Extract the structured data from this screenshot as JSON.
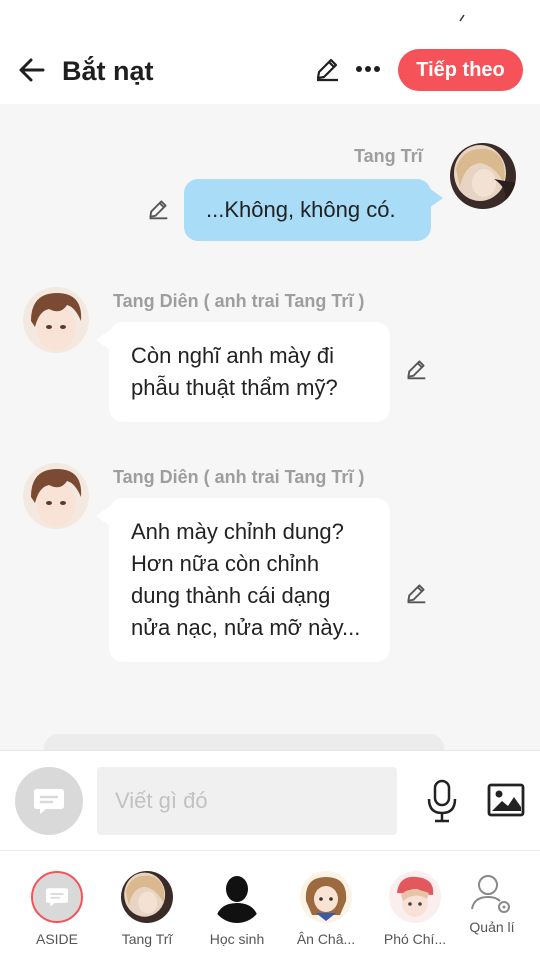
{
  "header": {
    "title": "Bắt nạt",
    "next_label": "Tiếp theo",
    "icons": {
      "back": "arrow-left-icon",
      "edit": "pencil-icon",
      "more": "more-dots-icon"
    },
    "accent_color": "#f5525a"
  },
  "messages": [
    {
      "side": "right",
      "sender": "Tang Trĩ",
      "text": "...Không, không có.",
      "bubble_color": "#a9dcf7"
    },
    {
      "side": "left",
      "sender": "Tang Diên ( anh trai Tang Trĩ )",
      "text": "Còn nghĩ anh mày đi phẫu thuật thẩm mỹ?",
      "bubble_color": "#ffffff"
    },
    {
      "side": "left",
      "sender": "Tang Diên ( anh trai Tang Trĩ )",
      "text": "Anh mày chỉnh dung? Hơn nữa còn chỉnh dung thành cái dạng nửa nạc, nửa mỡ này...",
      "bubble_color": "#ffffff"
    }
  ],
  "composer": {
    "placeholder": "Viết gì đó",
    "icons": {
      "aside": "chat-bubble-icon",
      "mic": "microphone-icon",
      "image": "image-icon"
    }
  },
  "characters": [
    {
      "label": "ASIDE",
      "icon": "chat-bubble-icon",
      "selected": true
    },
    {
      "label": "Tang Trĩ",
      "icon": "avatar-girl-blonde"
    },
    {
      "label": "Học sinh",
      "icon": "avatar-silhouette"
    },
    {
      "label": "Ân Châ...",
      "icon": "avatar-girl-brown-hair"
    },
    {
      "label": "Phó Chí...",
      "icon": "avatar-boy-red-cap"
    },
    {
      "label": "Quản lí",
      "icon": "manage-user-icon"
    }
  ]
}
